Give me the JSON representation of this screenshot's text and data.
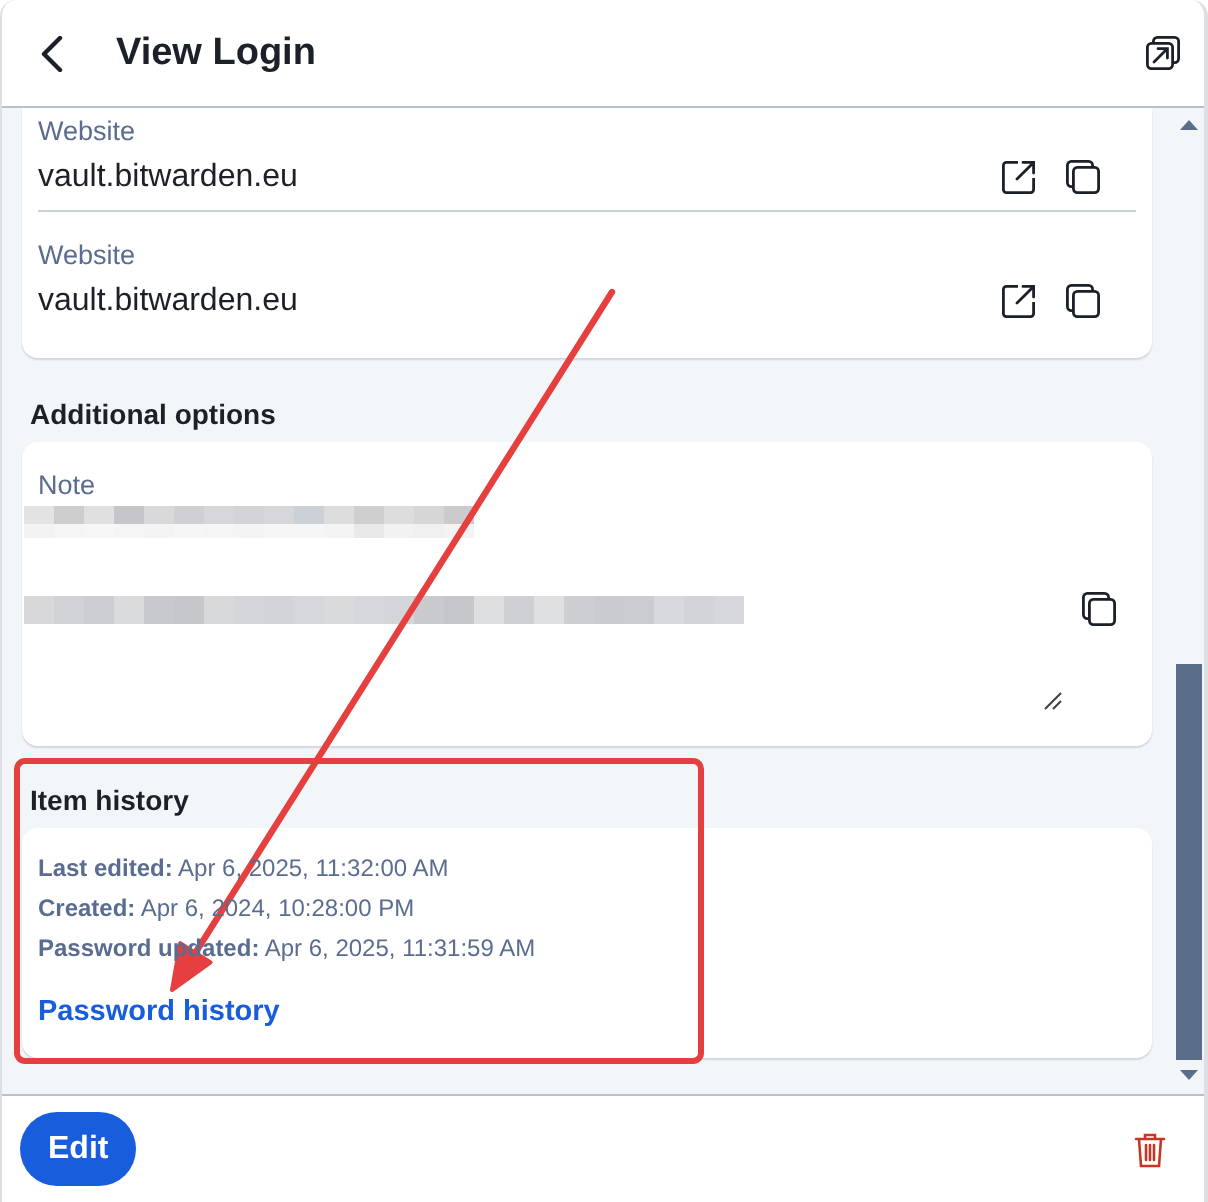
{
  "header": {
    "title": "View Login"
  },
  "login_card": {
    "websites": [
      {
        "label": "Website",
        "value": "vault.bitwarden.eu"
      },
      {
        "label": "Website",
        "value": "vault.bitwarden.eu"
      }
    ]
  },
  "additional_options": {
    "heading": "Additional options",
    "note": {
      "label": "Note",
      "redacted": true
    }
  },
  "item_history": {
    "heading": "Item history",
    "entries": [
      "**Last edited:** Apr 6, 2025, 11:32:00 AM",
      "**Created:** Apr 6, 2024, 10:28:00 PM",
      "**Password updated:** Apr 6, 2025, 11:31:59 AM"
    ],
    "link": "Password history"
  },
  "footer": {
    "edit_button": "Edit"
  },
  "annotations": {
    "highlight_rectangle": true,
    "arrow": true
  }
}
